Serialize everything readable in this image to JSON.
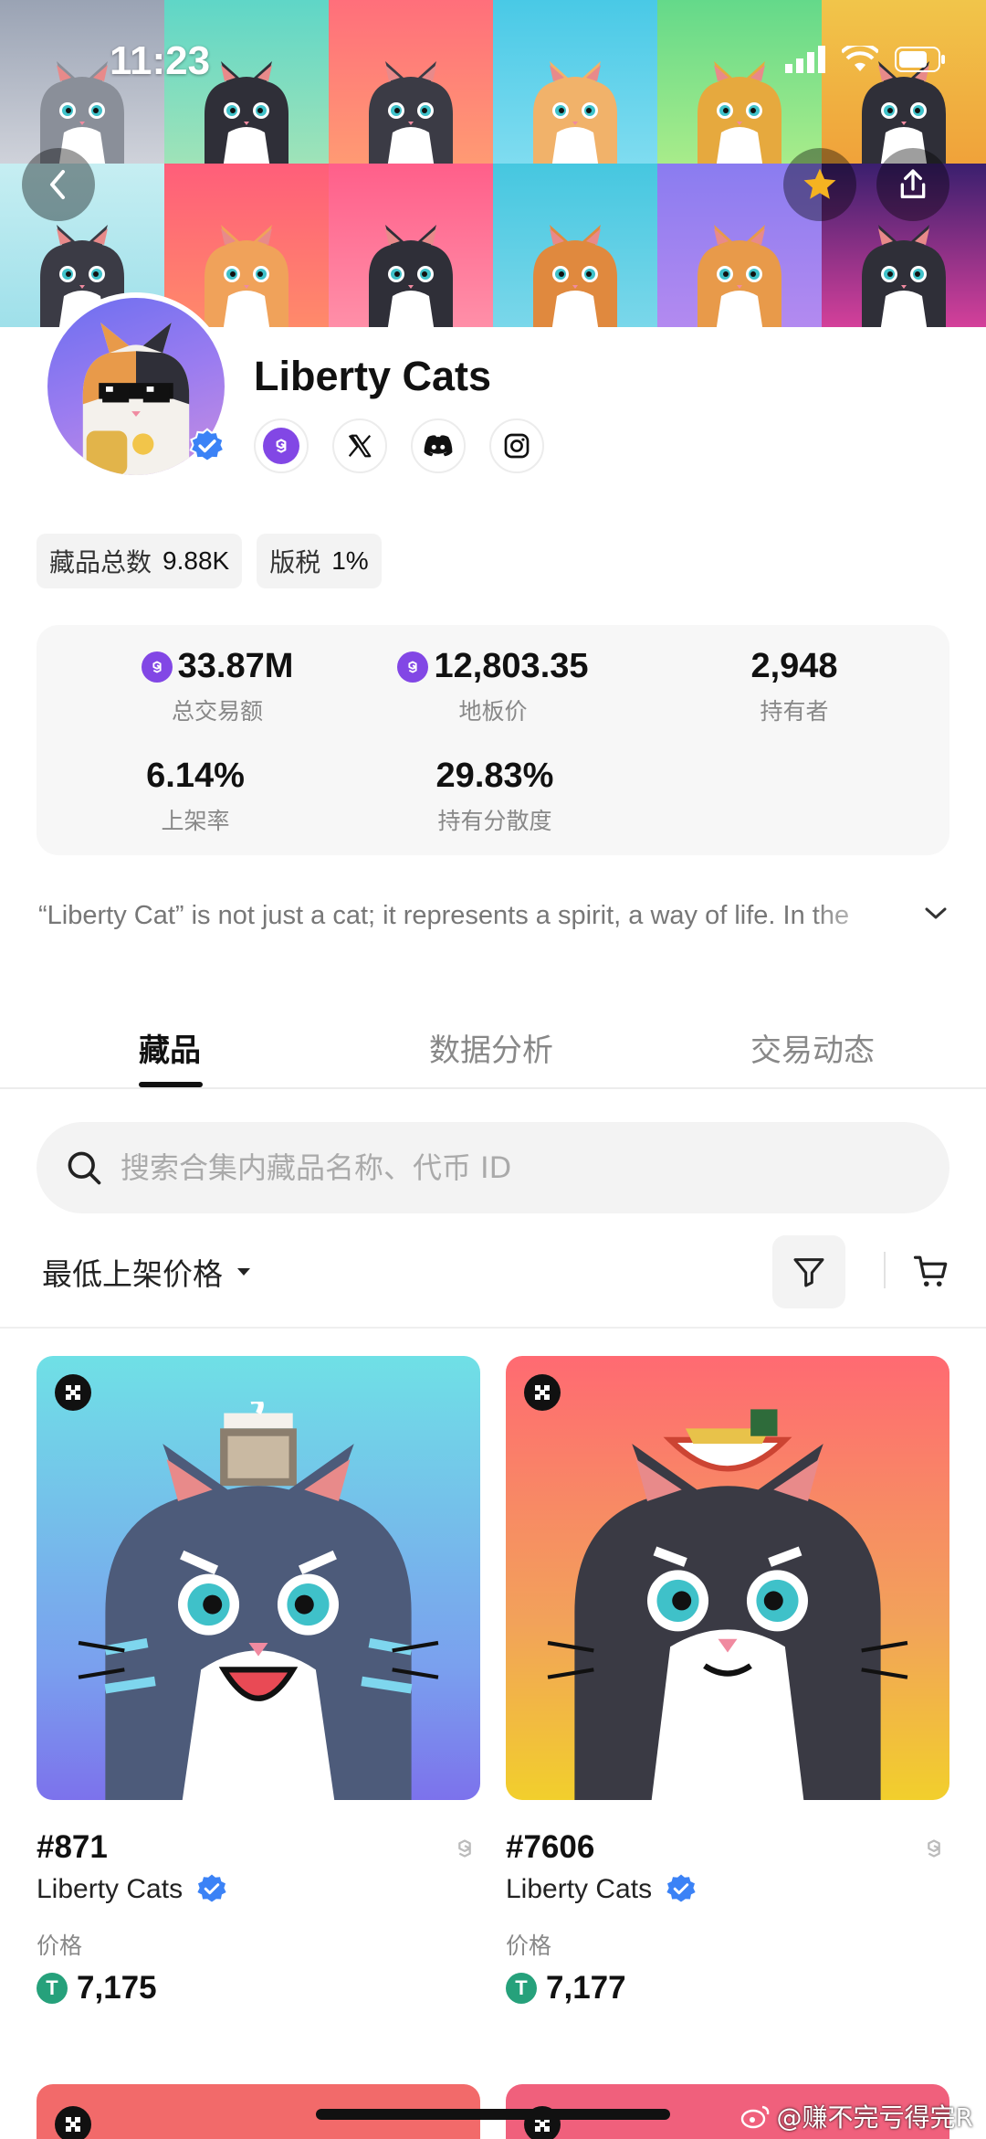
{
  "status_bar": {
    "time": "11:23"
  },
  "banner": {
    "tiles": [
      {
        "bg": "linear-gradient(180deg,#9aa3b4,#cfd2da)",
        "fur": "#8a8f99"
      },
      {
        "bg": "linear-gradient(180deg,#5fd6c7,#9fe3b8)",
        "fur": "#2f2f38"
      },
      {
        "bg": "linear-gradient(180deg,#ff6f7b,#ff9a73)",
        "fur": "#3b3b45"
      },
      {
        "bg": "linear-gradient(180deg,#49c9e6,#7fdcf0)",
        "fur": "#f1b26a"
      },
      {
        "bg": "linear-gradient(180deg,#64d98a,#a8ec8a)",
        "fur": "#e6a93e"
      },
      {
        "bg": "linear-gradient(180deg,#f1c54a,#f0a23a)",
        "fur": "#2f2f38"
      },
      {
        "bg": "linear-gradient(180deg,#c6eef2,#9fe0ea)",
        "fur": "#3b3b45"
      },
      {
        "bg": "linear-gradient(180deg,#ff5e7a,#ff8a6a)",
        "fur": "#f0a25a"
      },
      {
        "bg": "linear-gradient(180deg,#ff5f8a,#ff8fa8)",
        "fur": "#2f2f38"
      },
      {
        "bg": "linear-gradient(180deg,#46c7e0,#7ad7ea)",
        "fur": "#e0893e"
      },
      {
        "bg": "linear-gradient(180deg,#8a7cf0,#b38af0)",
        "fur": "#e89a4a"
      },
      {
        "bg": "linear-gradient(180deg,#3a1f6e,#d4409a)",
        "fur": "#2f2f38"
      }
    ]
  },
  "collection": {
    "name": "Liberty Cats",
    "socials": [
      "website-icon",
      "x-icon",
      "discord-icon",
      "instagram-icon"
    ],
    "pills": [
      {
        "label": "藏品总数",
        "value": "9.88K"
      },
      {
        "label": "版税",
        "value": "1%"
      }
    ],
    "stats": {
      "volume": {
        "value": "33.87M",
        "label": "总交易额"
      },
      "floor": {
        "value": "12,803.35",
        "label": "地板价"
      },
      "holders": {
        "value": "2,948",
        "label": "持有者"
      },
      "listed": {
        "value": "6.14%",
        "label": "上架率"
      },
      "distribution": {
        "value": "29.83%",
        "label": "持有分散度"
      }
    },
    "description": "“Liberty Cat” is not just a cat; it represents a spirit, a way of life. In the"
  },
  "tabs": [
    {
      "label": "藏品",
      "active": true
    },
    {
      "label": "数据分析",
      "active": false
    },
    {
      "label": "交易动态",
      "active": false
    }
  ],
  "search": {
    "placeholder": "搜索合集内藏品名称、代币 ID",
    "value": ""
  },
  "sort": {
    "label": "最低上架价格"
  },
  "items": [
    {
      "token": "#871",
      "collection": "Liberty Cats",
      "price_label": "价格",
      "price": "7,175",
      "bg": "linear-gradient(180deg,#6fe0e6 0%,#7aa0ee 70%,#7c72ec 100%)"
    },
    {
      "token": "#7606",
      "collection": "Liberty Cats",
      "price_label": "价格",
      "price": "7,177",
      "bg": "linear-gradient(180deg,#ff6a72 0%,#f2a25a 60%,#f2cf2c 100%)"
    }
  ],
  "partial_items": [
    {
      "bg": "#f26a6a"
    },
    {
      "bg": "#f0607c"
    }
  ],
  "watermark": "@赚不完亏得完R",
  "colors": {
    "accent": "#8247e5",
    "verified": "#3b82f6",
    "tether": "#26a17b"
  }
}
